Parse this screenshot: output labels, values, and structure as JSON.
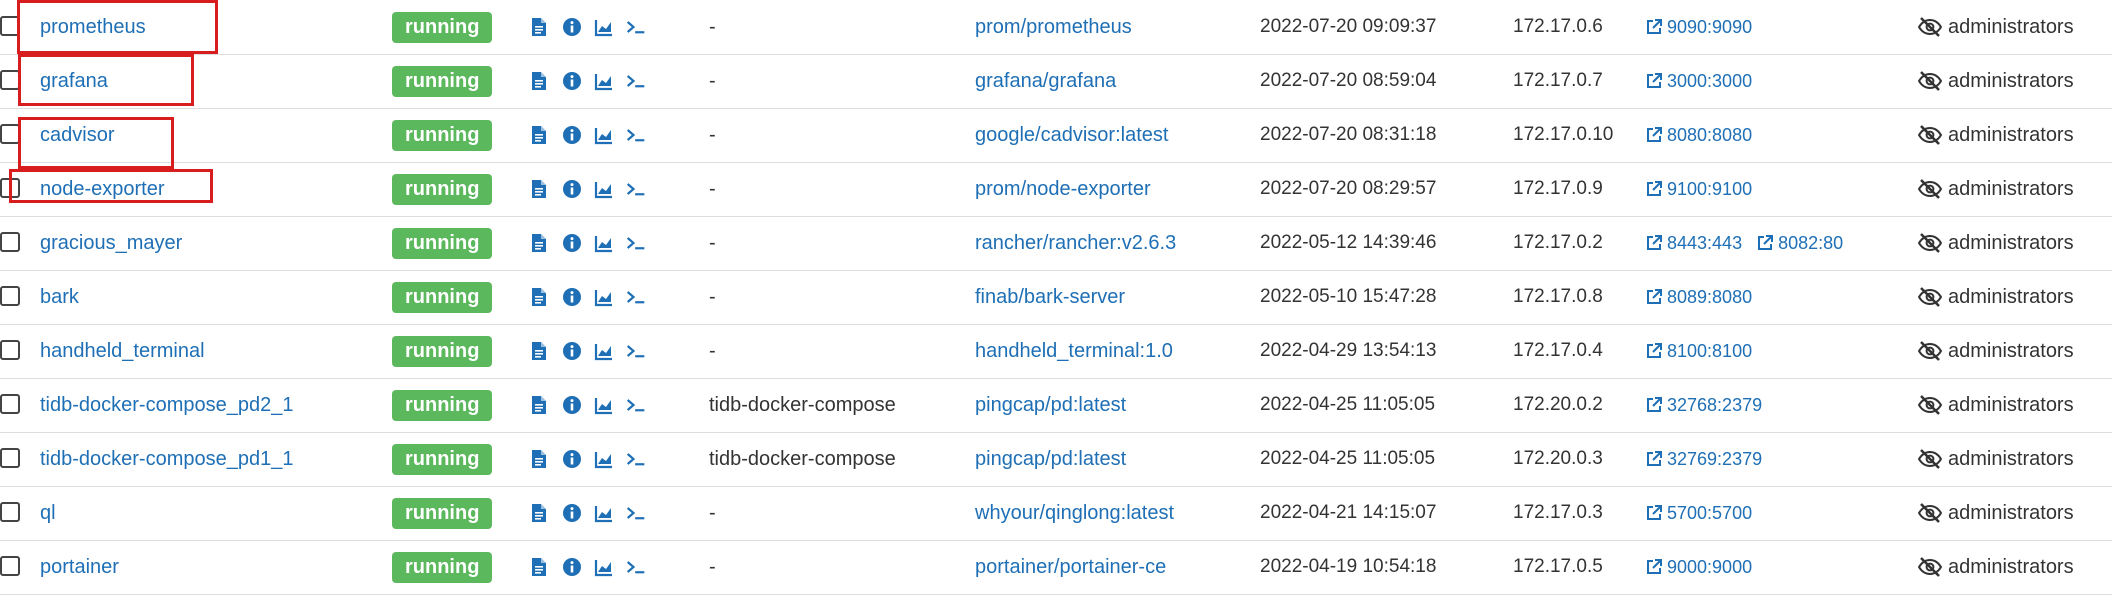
{
  "colors": {
    "link": "#1e6fb5",
    "running_badge": "#5cb85c",
    "highlight_box": "#d71d1d"
  },
  "containers": [
    {
      "name": "prometheus",
      "state": "running",
      "stack": "-",
      "image": "prom/prometheus",
      "created": "2022-07-20 09:09:37",
      "ip": "172.17.0.6",
      "ports": [
        "9090:9090"
      ],
      "ownership": "administrators"
    },
    {
      "name": "grafana",
      "state": "running",
      "stack": "-",
      "image": "grafana/grafana",
      "created": "2022-07-20 08:59:04",
      "ip": "172.17.0.7",
      "ports": [
        "3000:3000"
      ],
      "ownership": "administrators"
    },
    {
      "name": "cadvisor",
      "state": "running",
      "stack": "-",
      "image": "google/cadvisor:latest",
      "created": "2022-07-20 08:31:18",
      "ip": "172.17.0.10",
      "ports": [
        "8080:8080"
      ],
      "ownership": "administrators"
    },
    {
      "name": "node-exporter",
      "state": "running",
      "stack": "-",
      "image": "prom/node-exporter",
      "created": "2022-07-20 08:29:57",
      "ip": "172.17.0.9",
      "ports": [
        "9100:9100"
      ],
      "ownership": "administrators"
    },
    {
      "name": "gracious_mayer",
      "state": "running",
      "stack": "-",
      "image": "rancher/rancher:v2.6.3",
      "created": "2022-05-12 14:39:46",
      "ip": "172.17.0.2",
      "ports": [
        "8443:443",
        "8082:80"
      ],
      "ownership": "administrators"
    },
    {
      "name": "bark",
      "state": "running",
      "stack": "-",
      "image": "finab/bark-server",
      "created": "2022-05-10 15:47:28",
      "ip": "172.17.0.8",
      "ports": [
        "8089:8080"
      ],
      "ownership": "administrators"
    },
    {
      "name": "handheld_terminal",
      "state": "running",
      "stack": "-",
      "image": "handheld_terminal:1.0",
      "created": "2022-04-29 13:54:13",
      "ip": "172.17.0.4",
      "ports": [
        "8100:8100"
      ],
      "ownership": "administrators"
    },
    {
      "name": "tidb-docker-compose_pd2_1",
      "state": "running",
      "stack": "tidb-docker-compose",
      "image": "pingcap/pd:latest",
      "created": "2022-04-25 11:05:05",
      "ip": "172.20.0.2",
      "ports": [
        "32768:2379"
      ],
      "ownership": "administrators"
    },
    {
      "name": "tidb-docker-compose_pd1_1",
      "state": "running",
      "stack": "tidb-docker-compose",
      "image": "pingcap/pd:latest",
      "created": "2022-04-25 11:05:05",
      "ip": "172.20.0.3",
      "ports": [
        "32769:2379"
      ],
      "ownership": "administrators"
    },
    {
      "name": "ql",
      "state": "running",
      "stack": "-",
      "image": "whyour/qinglong:latest",
      "created": "2022-04-21 14:15:07",
      "ip": "172.17.0.3",
      "ports": [
        "5700:5700"
      ],
      "ownership": "administrators"
    },
    {
      "name": "portainer",
      "state": "running",
      "stack": "-",
      "image": "portainer/portainer-ce",
      "created": "2022-04-19 10:54:18",
      "ip": "172.17.0.5",
      "ports": [
        "9000:9000"
      ],
      "ownership": "administrators"
    }
  ],
  "quick_action_icons": [
    "logs-icon",
    "inspect-icon",
    "stats-icon",
    "console-icon"
  ],
  "highlighted_rows": [
    "prometheus",
    "grafana",
    "cadvisor",
    "node-exporter"
  ]
}
